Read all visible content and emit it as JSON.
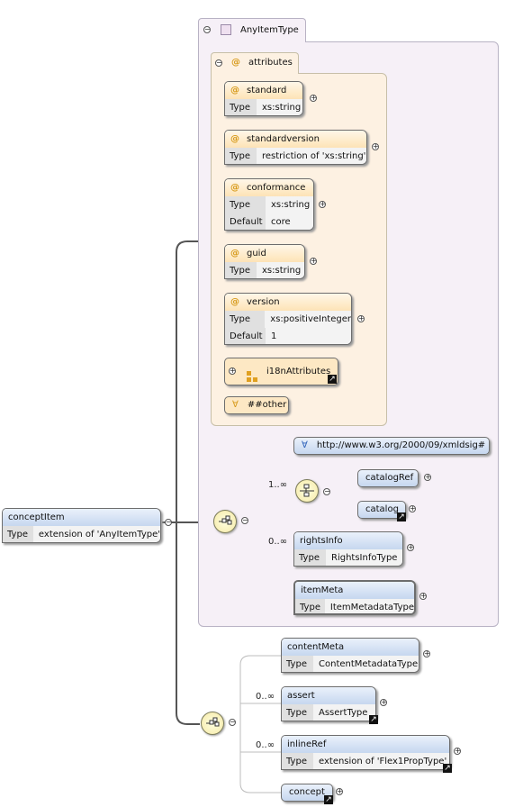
{
  "colors": {
    "element_header": "#c6d7ef",
    "attribute_header": "#fde3b6",
    "type_region": "#f6f0f7",
    "attribute_region": "#fdf1e2"
  },
  "root": {
    "name": "conceptItem",
    "type_key": "Type",
    "type_value": "extension of 'AnyItemType'"
  },
  "type_region": {
    "label": "AnyItemType"
  },
  "attributes_region": {
    "label": "attributes"
  },
  "attributes": [
    {
      "name": "standard",
      "rows": [
        {
          "k": "Type",
          "v": "xs:string"
        }
      ]
    },
    {
      "name": "standardversion",
      "rows": [
        {
          "k": "Type",
          "v": "restriction of 'xs:string'"
        }
      ]
    },
    {
      "name": "conformance",
      "rows": [
        {
          "k": "Type",
          "v": "xs:string"
        },
        {
          "k": "Default",
          "v": "core"
        }
      ]
    },
    {
      "name": "guid",
      "rows": [
        {
          "k": "Type",
          "v": "xs:string"
        }
      ]
    },
    {
      "name": "version",
      "rows": [
        {
          "k": "Type",
          "v": "xs:positiveInteger"
        },
        {
          "k": "Default",
          "v": "1"
        }
      ]
    }
  ],
  "attribute_group": {
    "name": "i18nAttributes"
  },
  "any_attribute": {
    "label": "##other"
  },
  "any_element": {
    "label": "http://www.w3.org/2000/09/xmldsig#"
  },
  "choice": {
    "occurrence": "1..∞",
    "children": [
      "catalogRef",
      "catalog"
    ]
  },
  "rightsInfo": {
    "occurrence": "0..∞",
    "name": "rightsInfo",
    "type_key": "Type",
    "type_value": "RightsInfoType"
  },
  "itemMeta": {
    "name": "itemMeta",
    "type_key": "Type",
    "type_value": "ItemMetadataType"
  },
  "contentMeta": {
    "name": "contentMeta",
    "type_key": "Type",
    "type_value": "ContentMetadataType"
  },
  "assert": {
    "occurrence": "0..∞",
    "name": "assert",
    "type_key": "Type",
    "type_value": "AssertType"
  },
  "inlineRef": {
    "occurrence": "0..∞",
    "name": "inlineRef",
    "type_key": "Type",
    "type_value": "extension of 'Flex1PropType'"
  },
  "concept": {
    "name": "concept"
  }
}
